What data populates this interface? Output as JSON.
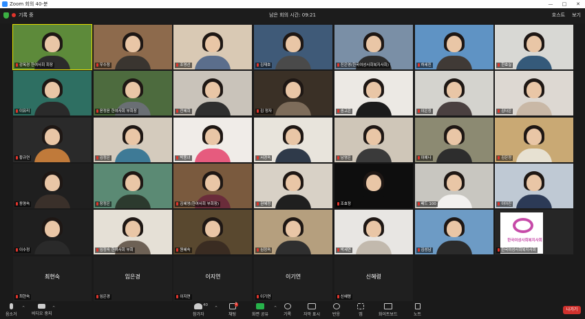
{
  "window": {
    "title": "Zoom 회의 40-분"
  },
  "topbar": {
    "recording_label": "기록 중",
    "remaining_time": "남은 회의 시간: 09:21",
    "host_label": "호스트",
    "view_label": "보기"
  },
  "tiles": [
    {
      "name": "강옥경 한여사회 회장",
      "bg": "#5d8a3a",
      "body": "#2b2b2b",
      "highlight": true
    },
    {
      "name": "우수정",
      "bg": "#8d6a4c",
      "body": "#3a3530"
    },
    {
      "name": "조영선",
      "bg": "#d9c9b4",
      "body": "#5b6e8c"
    },
    {
      "name": "김재호",
      "bg": "#3f5a78",
      "body": "#4a4a4a"
    },
    {
      "name": "진은영(한국여성사회복지사회)",
      "bg": "#7a8fa6",
      "body": "#2c2c2c"
    },
    {
      "name": "허세진",
      "bg": "#5f93c4",
      "body": "#403a36"
    },
    {
      "name": "한효실",
      "bg": "#d8d8d4",
      "body": "#355a7a"
    },
    {
      "name": "이유리",
      "bg": "#2e6f62",
      "body": "#2a2a2a"
    },
    {
      "name": "윤정윤 한여사회 부회장",
      "bg": "#4d6b3e",
      "body": "#6a6f74"
    },
    {
      "name": "전혜희",
      "bg": "#c9c3ba",
      "body": "#2f2f2f"
    },
    {
      "name": "김 정자",
      "bg": "#3a3026",
      "body": "#7d6c5a"
    },
    {
      "name": "송고은",
      "bg": "#ece9e4",
      "body": "#1b1b1b"
    },
    {
      "name": "이은정",
      "bg": "#d4d3ce",
      "body": "#4a4040"
    },
    {
      "name": "김다은",
      "bg": "#ddd8d2",
      "body": "#c9b8a6"
    },
    {
      "name": "황규연",
      "bg": "#2a2a2a",
      "body": "#c07a3a"
    },
    {
      "name": "김정은",
      "bg": "#d4cbbd",
      "body": "#3e7a96"
    },
    {
      "name": "박용녀",
      "bg": "#f0ece8",
      "body": "#e65b7e"
    },
    {
      "name": "서경숙",
      "bg": "#e8e4dc",
      "body": "#2f3a4a"
    },
    {
      "name": "남영은",
      "bg": "#cfc6b8",
      "body": "#3a3a3a"
    },
    {
      "name": "이예나",
      "bg": "#8c8a72",
      "body": "#2d2d2d"
    },
    {
      "name": "김은정",
      "bg": "#c9a974",
      "body": "#e7e1d2"
    },
    {
      "name": "동명숙",
      "bg": "#1f1f1f",
      "body": "#3a302a"
    },
    {
      "name": "장정은",
      "bg": "#5b8a74",
      "body": "#2c3a2e"
    },
    {
      "name": "김혜영(한여사회 부회장)",
      "bg": "#7a5a3e",
      "body": "#6a2c3a"
    },
    {
      "name": "권혜정",
      "bg": "#d8d1c6",
      "body": "#1f1f1f"
    },
    {
      "name": "조효정",
      "bg": "#0e0e0e",
      "body": "#0e0e0e"
    },
    {
      "name": "배드 100",
      "bg": "#c8c6c0",
      "body": "#f2f0ee"
    },
    {
      "name": "이아진",
      "bg": "#bfc9d4",
      "body": "#2c3a56"
    },
    {
      "name": "이수정",
      "bg": "#1f1f1f",
      "body": "#2a2a2a"
    },
    {
      "name": "임정숙 한여사회 부회",
      "bg": "#e5e0d6",
      "body": "#6d6155"
    },
    {
      "name": "원혜숙",
      "bg": "#59482f",
      "body": "#3a2c22"
    },
    {
      "name": "심정숙",
      "bg": "#b59f7e",
      "body": "#2f2f2f"
    },
    {
      "name": "박세연",
      "bg": "#e8e6e3",
      "body": "#c2b9ad"
    },
    {
      "name": "김성남",
      "bg": "#6d9bc5",
      "body": "#2b2b2b"
    },
    {
      "name": "한국여성사회복지사회",
      "bg": "#ffffff",
      "body": "#ffffff",
      "logo": true,
      "logo_text": "한국여성사회복지사회"
    },
    {
      "bigname": "최현숙",
      "name": "최현숙",
      "camoff": true
    },
    {
      "bigname": "임은경",
      "name": "임은경",
      "camoff": true
    },
    {
      "bigname": "이지연",
      "name": "이지연",
      "camoff": true
    },
    {
      "bigname": "이기연",
      "name": "이기연",
      "camoff": true
    },
    {
      "bigname": "신혜령",
      "name": "신혜령",
      "camoff": true
    }
  ],
  "toolbar": {
    "mute": "음소거",
    "video": "비디오 중지",
    "participants": "참가자",
    "participants_count": "40",
    "chat": "채팅",
    "chat_badge": "1",
    "share": "화면 공유",
    "record": "기록",
    "captions": "자막 표시",
    "reactions": "반응",
    "apps": "앱",
    "whiteboard": "화이트보드",
    "notes": "노트",
    "leave": "나가기"
  },
  "colors": {
    "highlight": "#e8e200",
    "leave": "#d0312d",
    "share": "#27b34b",
    "mic_muted": "#e0342b"
  }
}
